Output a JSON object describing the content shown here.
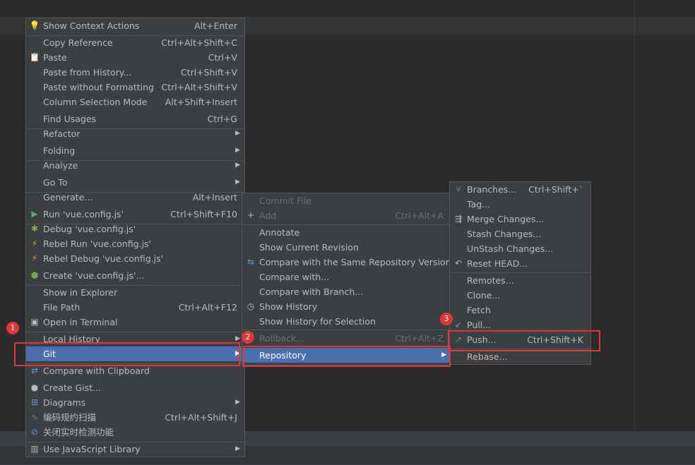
{
  "menu1": {
    "items": [
      {
        "label": "Show Context Actions",
        "shortcut": "Alt+Enter",
        "icon": "lightbulb-icon",
        "glyph": "💡"
      },
      {
        "label": "Copy Reference",
        "shortcut": "Ctrl+Alt+Shift+C"
      },
      {
        "label": "Paste",
        "shortcut": "Ctrl+V",
        "icon": "clipboard-icon",
        "glyph": "📋"
      },
      {
        "label": "Paste from History...",
        "shortcut": "Ctrl+Shift+V"
      },
      {
        "label": "Paste without Formatting",
        "shortcut": "Ctrl+Alt+Shift+V"
      },
      {
        "label": "Column Selection Mode",
        "shortcut": "Alt+Shift+Insert"
      },
      {
        "label": "Find Usages",
        "shortcut": "Ctrl+G"
      },
      {
        "label": "Refactor",
        "submenu": true
      },
      {
        "label": "Folding",
        "submenu": true
      },
      {
        "label": "Analyze",
        "submenu": true
      },
      {
        "label": "Go To",
        "submenu": true
      },
      {
        "label": "Generate...",
        "shortcut": "Alt+Insert"
      },
      {
        "label": "Run 'vue.config.js'",
        "shortcut": "Ctrl+Shift+F10",
        "icon": "run-icon",
        "glyph": "▶"
      },
      {
        "label": "Debug 'vue.config.js'",
        "icon": "debug-icon",
        "glyph": "✱"
      },
      {
        "label": "Rebel Run 'vue.config.js'",
        "icon": "jrebel-run-icon",
        "glyph": "⚡"
      },
      {
        "label": "Rebel Debug 'vue.config.js'",
        "icon": "jrebel-debug-icon",
        "glyph": "⚡"
      },
      {
        "label": "Create 'vue.config.js'...",
        "icon": "nodejs-icon",
        "glyph": "⬢"
      },
      {
        "label": "Show in Explorer"
      },
      {
        "label": "File Path",
        "shortcut": "Ctrl+Alt+F12"
      },
      {
        "label": "Open in Terminal",
        "icon": "terminal-icon",
        "glyph": "▣"
      },
      {
        "label": "Local History",
        "submenu": true
      },
      {
        "label": "Git",
        "submenu": true,
        "selected": true
      },
      {
        "label": "Compare with Clipboard",
        "icon": "compare-icon",
        "glyph": "⇄"
      },
      {
        "label": "Create Gist...",
        "icon": "github-icon",
        "glyph": "●"
      },
      {
        "label": "Diagrams",
        "submenu": true,
        "icon": "diagram-icon",
        "glyph": "⊞"
      },
      {
        "label": "编码规约扫描",
        "shortcut": "Ctrl+Alt+Shift+J",
        "icon": "code-scan-icon",
        "glyph": "∿"
      },
      {
        "label": "关闭实时检测功能",
        "icon": "disable-icon",
        "glyph": "⊘"
      },
      {
        "label": "Use JavaScript Library",
        "submenu": true,
        "icon": "library-icon",
        "glyph": "▥"
      }
    ]
  },
  "menu2": {
    "items": [
      {
        "label": "Commit File",
        "disabled": true
      },
      {
        "label": "Add",
        "shortcut": "Ctrl+Alt+A",
        "disabled": true,
        "icon": "plus-icon",
        "glyph": "+"
      },
      {
        "label": "Annotate"
      },
      {
        "label": "Show Current Revision"
      },
      {
        "label": "Compare with the Same Repository Version",
        "icon": "compare-arrows-icon",
        "glyph": "⇆"
      },
      {
        "label": "Compare with..."
      },
      {
        "label": "Compare with Branch..."
      },
      {
        "label": "Show History",
        "icon": "history-clock-icon",
        "glyph": "◷"
      },
      {
        "label": "Show History for Selection"
      },
      {
        "label": "Rollback...",
        "shortcut": "Ctrl+Alt+Z",
        "disabled": true
      },
      {
        "label": "Repository",
        "submenu": true,
        "selected": true
      }
    ]
  },
  "menu3": {
    "items": [
      {
        "label": "Branches...",
        "shortcut": "Ctrl+Shift+`",
        "icon": "branch-icon",
        "glyph": "⑂"
      },
      {
        "label": "Tag..."
      },
      {
        "label": "Merge Changes...",
        "icon": "merge-icon",
        "glyph": "⇶"
      },
      {
        "label": "Stash Changes..."
      },
      {
        "label": "UnStash Changes..."
      },
      {
        "label": "Reset HEAD...",
        "icon": "reset-icon",
        "glyph": "↶"
      },
      {
        "label": "Remotes..."
      },
      {
        "label": "Clone..."
      },
      {
        "label": "Fetch"
      },
      {
        "label": "Pull...",
        "icon": "pull-arrow-icon",
        "glyph": "↙"
      },
      {
        "label": "Push...",
        "shortcut": "Ctrl+Shift+K",
        "icon": "push-arrow-icon",
        "glyph": "↗"
      },
      {
        "label": "Rebase..."
      }
    ]
  },
  "badges": [
    "1",
    "2",
    "3"
  ],
  "colors": {
    "menu_bg": "#3c3f41",
    "selection": "#4b6eaf",
    "highlight": "#e0353a",
    "editor_bg": "#2b2b2b"
  }
}
